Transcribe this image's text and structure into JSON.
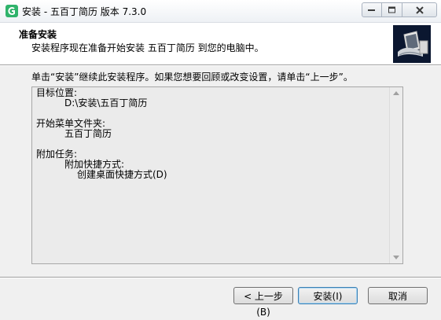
{
  "window": {
    "title": "安装 - 五百丁简历 版本 7.3.0"
  },
  "header": {
    "title": "准备安装",
    "subtitle": "安装程序现在准备开始安装 五百丁简历 到您的电脑中。"
  },
  "instruction": "单击“安装”继续此安装程序。如果您想要回顾或改变设置，请单击“上一步”。",
  "memo": {
    "dest_label": "目标位置:",
    "dest_value": "D:\\安装\\五百丁简历",
    "menu_label": "开始菜单文件夹:",
    "menu_value": "五百丁简历",
    "tasks_label": "附加任务:",
    "shortcut_group": "附加快捷方式:",
    "shortcut_item": "创建桌面快捷方式(D)"
  },
  "buttons": {
    "back": "< 上一步(B)",
    "install": "安装(I)",
    "cancel": "取消"
  },
  "colors": {
    "app_icon": "#2fb36b",
    "wizard_image_bg": "#0b1730"
  }
}
